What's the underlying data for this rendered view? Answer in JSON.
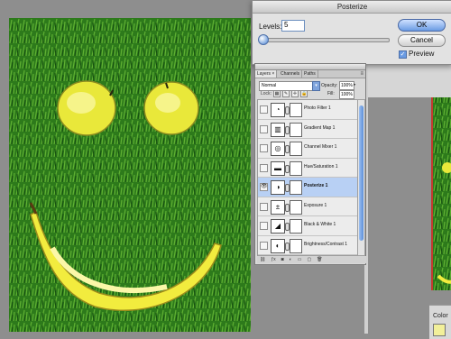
{
  "dialog": {
    "title": "Posterize",
    "levels_label": "Levels:",
    "levels_value": "5",
    "ok_label": "OK",
    "cancel_label": "Cancel",
    "preview_label": "Preview",
    "preview_checked": true
  },
  "layers_panel": {
    "tabs": [
      "Layers ×",
      "Channels",
      "Paths"
    ],
    "blend_mode": "Normal",
    "opacity_label": "Opacity:",
    "opacity_value": "100%",
    "lock_label": "Lock:",
    "fill_label": "Fill:",
    "fill_value": "100%",
    "layers": [
      {
        "name": "Photo Filter 1",
        "icon": "photo-filter-icon",
        "selected": false
      },
      {
        "name": "Gradient Map 1",
        "icon": "gradient-map-icon",
        "selected": false
      },
      {
        "name": "Channel Mixer 1",
        "icon": "channel-mixer-icon",
        "selected": false
      },
      {
        "name": "Hue/Saturation 1",
        "icon": "hue-saturation-icon",
        "selected": false
      },
      {
        "name": "Posterize 1",
        "icon": "posterize-icon",
        "selected": true
      },
      {
        "name": "Exposure 1",
        "icon": "exposure-icon",
        "selected": false
      },
      {
        "name": "Black & White 1",
        "icon": "black-white-icon",
        "selected": false
      },
      {
        "name": "Brightness/Contrast 1",
        "icon": "brightness-contrast-icon",
        "selected": false
      }
    ]
  },
  "color_panel": {
    "tab_label": "Color"
  },
  "colors": {
    "grass": "#2f7f1c",
    "fruit": "#f2ec3e",
    "accent": "#6a9be3"
  }
}
